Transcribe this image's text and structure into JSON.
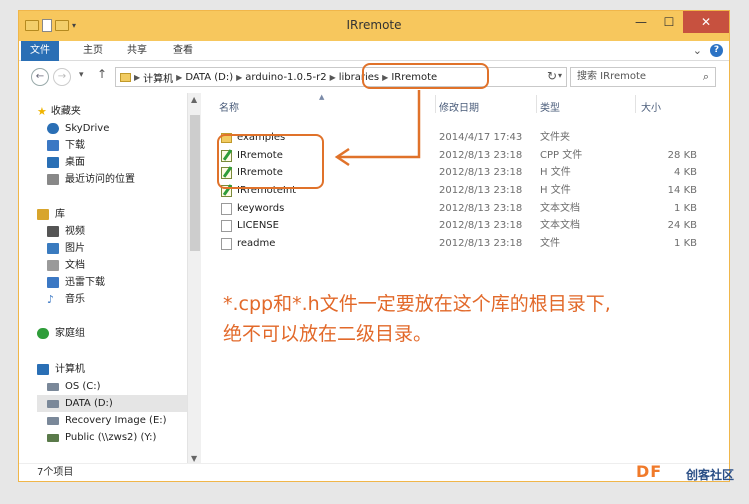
{
  "window": {
    "title": "IRremote",
    "close_glyph": "✕",
    "minimize_glyph": "—",
    "maximize_glyph": "☐"
  },
  "ribbon": {
    "tabs": [
      "文件",
      "主页",
      "共享",
      "查看"
    ],
    "expand_glyph": "⌄",
    "help_glyph": "?"
  },
  "address": {
    "path": [
      "计算机",
      "DATA (D:)",
      "arduino-1.0.5-r2",
      "libraries",
      "IRremote"
    ],
    "search_placeholder": "搜索 IRremote"
  },
  "nav_pane": {
    "items": [
      {
        "label": "收藏夹",
        "icon": "star-icon",
        "color": "#f0b400"
      },
      {
        "label": "SkyDrive",
        "icon": "cloud-icon",
        "color": "#2a6fb5"
      },
      {
        "label": "下载",
        "icon": "download-folder-icon",
        "color": "#3b78c4"
      },
      {
        "label": "桌面",
        "icon": "desktop-icon",
        "color": "#2a6fb5"
      },
      {
        "label": "最近访问的位置",
        "icon": "recent-places-icon",
        "color": "#888888"
      },
      {
        "label": "库",
        "icon": "library-icon",
        "color": "#d8a52c"
      },
      {
        "label": "视频",
        "icon": "video-icon",
        "color": "#555555"
      },
      {
        "label": "图片",
        "icon": "pictures-icon",
        "color": "#3a7bbf"
      },
      {
        "label": "文档",
        "icon": "documents-icon",
        "color": "#9a9a9a"
      },
      {
        "label": "迅雷下载",
        "icon": "thunder-download-icon",
        "color": "#3b78c4"
      },
      {
        "label": "音乐",
        "icon": "music-icon",
        "color": "#3b78c4"
      },
      {
        "label": "家庭组",
        "icon": "homegroup-icon",
        "color": "#2f9d3a"
      },
      {
        "label": "计算机",
        "icon": "computer-icon",
        "color": "#2a6fb5"
      },
      {
        "label": "OS (C:)",
        "icon": "drive-icon",
        "color": "#7a8899"
      },
      {
        "label": "DATA (D:)",
        "icon": "drive-icon",
        "color": "#7a8899"
      },
      {
        "label": "Recovery Image (E:)",
        "icon": "drive-icon",
        "color": "#7a8899"
      },
      {
        "label": "Public (\\\\zws2) (Y:)",
        "icon": "network-drive-icon",
        "color": "#5a7a4a"
      }
    ]
  },
  "list": {
    "headers": {
      "name": "名称",
      "date": "修改日期",
      "type": "类型",
      "size": "大小"
    },
    "rows": [
      {
        "name": "examples",
        "date": "2014/4/17 17:43",
        "type": "文件夹",
        "size": "",
        "icon": "folder-icon"
      },
      {
        "name": "IRremote",
        "date": "2012/8/13 23:18",
        "type": "CPP 文件",
        "size": "28 KB",
        "icon": "code-file-icon"
      },
      {
        "name": "IRremote",
        "date": "2012/8/13 23:18",
        "type": "H 文件",
        "size": "4 KB",
        "icon": "code-file-icon"
      },
      {
        "name": "IRremoteInt",
        "date": "2012/8/13 23:18",
        "type": "H 文件",
        "size": "14 KB",
        "icon": "code-file-icon"
      },
      {
        "name": "keywords",
        "date": "2012/8/13 23:18",
        "type": "文本文档",
        "size": "1 KB",
        "icon": "text-file-icon"
      },
      {
        "name": "LICENSE",
        "date": "2012/8/13 23:18",
        "type": "文本文档",
        "size": "24 KB",
        "icon": "text-file-icon"
      },
      {
        "name": "readme",
        "date": "2012/8/13 23:18",
        "type": "文件",
        "size": "1 KB",
        "icon": "text-file-icon"
      }
    ]
  },
  "annotation": {
    "line1": "*.cpp和*.h文件一定要放在这个库的根目录下,",
    "line2": "绝不可以放在二级目录。",
    "color": "#e0722a"
  },
  "status": {
    "item_count": "7个项目"
  },
  "watermark": {
    "brand": "DF",
    "text": "创客社区"
  }
}
